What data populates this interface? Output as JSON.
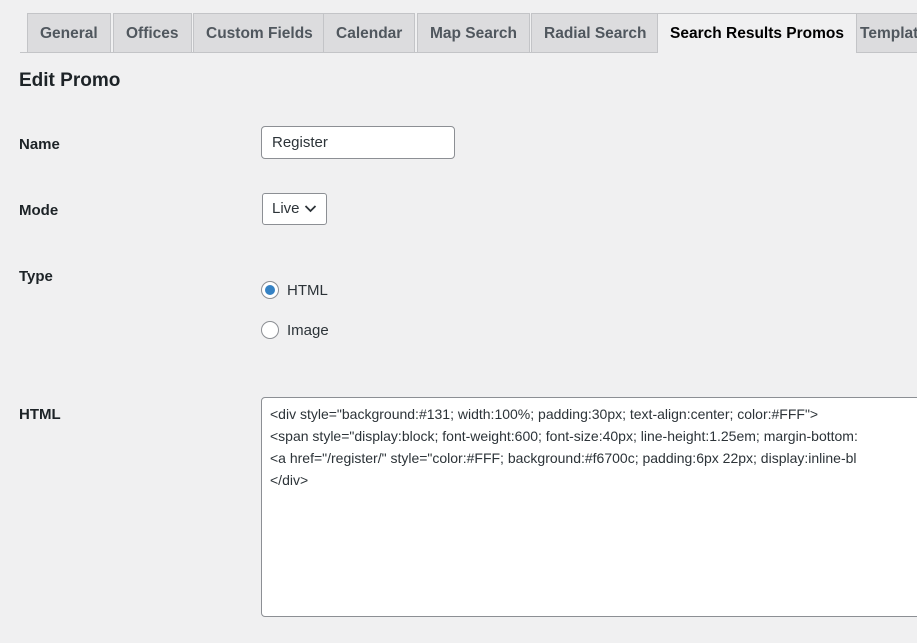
{
  "tabs": [
    {
      "label": "General",
      "active": false
    },
    {
      "label": "Offices",
      "active": false
    },
    {
      "label": "Custom Fields",
      "active": false
    },
    {
      "label": "Calendar",
      "active": false
    },
    {
      "label": "Map Search",
      "active": false
    },
    {
      "label": "Radial Search",
      "active": false
    },
    {
      "label": "Search Results Promos",
      "active": true
    },
    {
      "label": "Templates",
      "active": false
    }
  ],
  "page": {
    "heading": "Edit Promo"
  },
  "form": {
    "name_label": "Name",
    "name_value": "Register",
    "mode_label": "Mode",
    "mode_selected": "Live",
    "type_label": "Type",
    "type_options": [
      {
        "label": "HTML",
        "checked": true
      },
      {
        "label": "Image",
        "checked": false
      }
    ],
    "html_label": "HTML",
    "html_lines": [
      "<div style=\"background:#131; width:100%; padding:30px; text-align:center; color:#FFF\">",
      "<span style=\"display:block; font-weight:600; font-size:40px; line-height:1.25em; margin-bottom:",
      "<a href=\"/register/\" style=\"color:#FFF; background:#f6700c; padding:6px 22px; display:inline-bl",
      "</div>"
    ]
  },
  "colors": {
    "radio_accent": "#3582c4",
    "page_background": "#f0f0f1",
    "tab_inactive": "#dcdcde"
  }
}
